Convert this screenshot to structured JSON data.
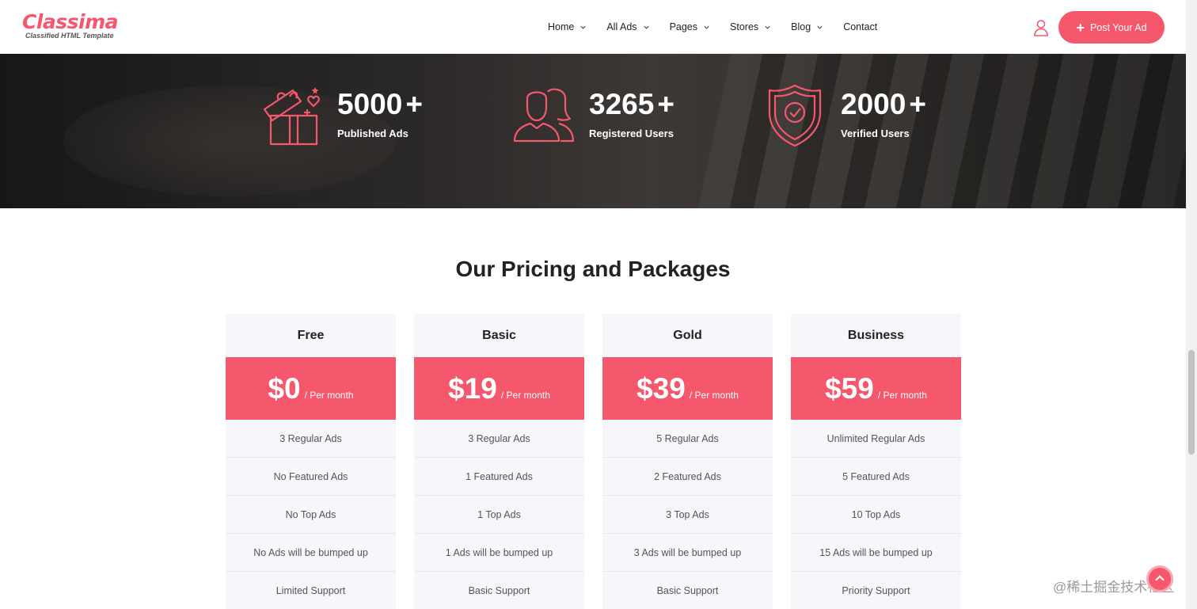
{
  "brand": {
    "name": "Classima",
    "tagline": "Classified HTML Template",
    "accent": "#f5576c"
  },
  "nav": [
    {
      "label": "Home",
      "has_dropdown": true
    },
    {
      "label": "All Ads",
      "has_dropdown": true
    },
    {
      "label": "Pages",
      "has_dropdown": true
    },
    {
      "label": "Stores",
      "has_dropdown": true
    },
    {
      "label": "Blog",
      "has_dropdown": true
    },
    {
      "label": "Contact",
      "has_dropdown": false
    }
  ],
  "header": {
    "user_icon": "user-icon",
    "post_ad_label": "Post Your Ad",
    "post_ad_icon": "plus-icon"
  },
  "stats": [
    {
      "value": "5000",
      "suffix": "+",
      "label": "Published Ads",
      "icon": "gift-box-icon"
    },
    {
      "value": "3265",
      "suffix": "+",
      "label": "Registered Users",
      "icon": "users-icon"
    },
    {
      "value": "2000",
      "suffix": "+",
      "label": "Verified Users",
      "icon": "shield-check-icon"
    }
  ],
  "pricing": {
    "title": "Our Pricing and Packages",
    "plans": [
      {
        "name": "Free",
        "price": "$0",
        "period": "/ Per month",
        "features": [
          "3 Regular Ads",
          "No Featured Ads",
          "No Top Ads",
          "No Ads will be bumped up",
          "Limited Support"
        ]
      },
      {
        "name": "Basic",
        "price": "$19",
        "period": "/ Per month",
        "features": [
          "3 Regular Ads",
          "1 Featured Ads",
          "1 Top Ads",
          "1 Ads will be bumped up",
          "Basic Support"
        ]
      },
      {
        "name": "Gold",
        "price": "$39",
        "period": "/ Per month",
        "features": [
          "5 Regular Ads",
          "2 Featured Ads",
          "3 Top Ads",
          "3 Ads will be bumped up",
          "Basic Support"
        ]
      },
      {
        "name": "Business",
        "price": "$59",
        "period": "/ Per month",
        "features": [
          "Unlimited Regular Ads",
          "5 Featured Ads",
          "10 Top Ads",
          "15 Ads will be bumped up",
          "Priority Support"
        ]
      }
    ]
  },
  "watermark": "@稀土掘金技术社区",
  "back_to_top_icon": "arrow-up-icon"
}
